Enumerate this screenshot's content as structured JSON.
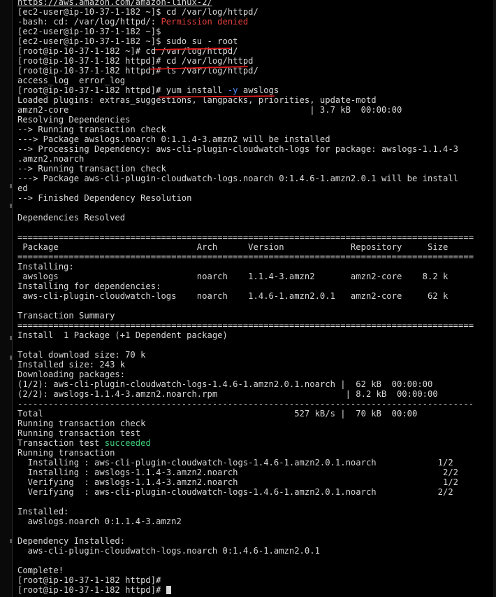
{
  "terminal": {
    "lines": [
      {
        "segments": [
          {
            "text": "https://aws.amazon.com/amazon-linux-2/",
            "kind": "link"
          }
        ]
      },
      {
        "segments": [
          {
            "text": "[ec2-user@ip-10-37-1-182 ~]$ cd /var/log/httpd/"
          }
        ]
      },
      {
        "segments": [
          {
            "text": "-bash: cd: /var/log/httpd/: "
          },
          {
            "text": "Permission denied",
            "kind": "err"
          }
        ]
      },
      {
        "segments": [
          {
            "text": "[ec2-user@ip-10-37-1-182 ~]$"
          }
        ]
      },
      {
        "segments": [
          {
            "text": "[ec2-user@ip-10-37-1-182 ~]$ sudo su - root"
          }
        ]
      },
      {
        "segments": [
          {
            "text": "[root@ip-10-37-1-182 ~]# cd /var/log/httpd/"
          }
        ]
      },
      {
        "segments": [
          {
            "text": "[root@ip-10-37-1-182 httpd]# cd /var/log/httpd"
          }
        ]
      },
      {
        "segments": [
          {
            "text": "[root@ip-10-37-1-182 httpd]# ls /var/log/httpd/"
          }
        ]
      },
      {
        "segments": [
          {
            "text": "access_log  error_log"
          }
        ]
      },
      {
        "segments": [
          {
            "text": "[root@ip-10-37-1-182 httpd]# yum install "
          },
          {
            "text": "-y",
            "kind": "opt"
          },
          {
            "text": " awslogs"
          }
        ]
      },
      {
        "segments": [
          {
            "text": "Loaded plugins: extras_suggestions, langpacks, priorities, update-motd"
          }
        ]
      },
      {
        "segments": [
          {
            "text": "amzn2-core                                               | 3.7 kB  00:00:00"
          }
        ]
      },
      {
        "segments": [
          {
            "text": "Resolving Dependencies"
          }
        ]
      },
      {
        "segments": [
          {
            "text": "--> Running transaction check"
          }
        ]
      },
      {
        "segments": [
          {
            "text": "---> Package awslogs.noarch 0:1.1.4-3.amzn2 will be installed"
          }
        ]
      },
      {
        "segments": [
          {
            "text": "--> Processing Dependency: aws-cli-plugin-cloudwatch-logs for package: awslogs-1.1.4-3"
          }
        ]
      },
      {
        "segments": [
          {
            "text": ".amzn2.noarch"
          }
        ]
      },
      {
        "segments": [
          {
            "text": "--> Running transaction check"
          }
        ]
      },
      {
        "segments": [
          {
            "text": "---> Package aws-cli-plugin-cloudwatch-logs.noarch 0:1.4.6-1.amzn2.0.1 will be install"
          }
        ]
      },
      {
        "segments": [
          {
            "text": "ed"
          }
        ]
      },
      {
        "segments": [
          {
            "text": "--> Finished Dependency Resolution"
          }
        ]
      },
      {
        "segments": [
          {
            "text": ""
          }
        ]
      },
      {
        "segments": [
          {
            "text": "Dependencies Resolved"
          }
        ]
      },
      {
        "segments": [
          {
            "text": ""
          }
        ]
      },
      {
        "segments": [
          {
            "text": "========================================================================================="
          }
        ]
      },
      {
        "segments": [
          {
            "text": " Package                           Arch      Version             Repository     Size"
          }
        ]
      },
      {
        "segments": [
          {
            "text": "========================================================================================="
          }
        ]
      },
      {
        "segments": [
          {
            "text": "Installing:"
          }
        ]
      },
      {
        "segments": [
          {
            "text": " awslogs                           noarch    1.1.4-3.amzn2       amzn2-core    8.2 k"
          }
        ]
      },
      {
        "segments": [
          {
            "text": "Installing for dependencies:"
          }
        ]
      },
      {
        "segments": [
          {
            "text": " aws-cli-plugin-cloudwatch-logs    noarch    1.4.6-1.amzn2.0.1   amzn2-core     62 k"
          }
        ]
      },
      {
        "segments": [
          {
            "text": ""
          }
        ]
      },
      {
        "segments": [
          {
            "text": "Transaction Summary"
          }
        ]
      },
      {
        "segments": [
          {
            "text": "========================================================================================="
          }
        ]
      },
      {
        "segments": [
          {
            "text": "Install  1 Package (+1 Dependent package)"
          }
        ]
      },
      {
        "segments": [
          {
            "text": ""
          }
        ]
      },
      {
        "segments": [
          {
            "text": "Total download size: 70 k"
          }
        ]
      },
      {
        "segments": [
          {
            "text": "Installed size: 243 k"
          }
        ]
      },
      {
        "segments": [
          {
            "text": "Downloading packages:"
          }
        ]
      },
      {
        "segments": [
          {
            "text": "(1/2): aws-cli-plugin-cloudwatch-logs-1.4.6-1.amzn2.0.1.noarch |  62 kB  00:00:00"
          }
        ]
      },
      {
        "segments": [
          {
            "text": "(2/2): awslogs-1.1.4-3.amzn2.noarch.rpm                         | 8.2 kB  00:00:00"
          }
        ]
      },
      {
        "segments": [
          {
            "text": "-----------------------------------------------------------------------------------------"
          }
        ]
      },
      {
        "segments": [
          {
            "text": "Total                                                 527 kB/s |  70 kB  00:00"
          }
        ]
      },
      {
        "segments": [
          {
            "text": "Running transaction check"
          }
        ]
      },
      {
        "segments": [
          {
            "text": "Running transaction test"
          }
        ]
      },
      {
        "segments": [
          {
            "text": "Transaction test "
          },
          {
            "text": "succeeded",
            "kind": "ok"
          }
        ]
      },
      {
        "segments": [
          {
            "text": "Running transaction"
          }
        ]
      },
      {
        "segments": [
          {
            "text": "  Installing : aws-cli-plugin-cloudwatch-logs-1.4.6-1.amzn2.0.1.noarch            1/2"
          }
        ]
      },
      {
        "segments": [
          {
            "text": "  Installing : awslogs-1.1.4-3.amzn2.noarch                                        2/2"
          }
        ]
      },
      {
        "segments": [
          {
            "text": "  Verifying  : awslogs-1.1.4-3.amzn2.noarch                                        1/2"
          }
        ]
      },
      {
        "segments": [
          {
            "text": "  Verifying  : aws-cli-plugin-cloudwatch-logs-1.4.6-1.amzn2.0.1.noarch            2/2"
          }
        ]
      },
      {
        "segments": [
          {
            "text": ""
          }
        ]
      },
      {
        "segments": [
          {
            "text": "Installed:"
          }
        ]
      },
      {
        "segments": [
          {
            "text": "  awslogs.noarch 0:1.1.4-3.amzn2"
          }
        ]
      },
      {
        "segments": [
          {
            "text": ""
          }
        ]
      },
      {
        "segments": [
          {
            "text": "Dependency Installed:"
          }
        ]
      },
      {
        "segments": [
          {
            "text": "  aws-cli-plugin-cloudwatch-logs.noarch 0:1.4.6-1.amzn2.0.1"
          }
        ]
      },
      {
        "segments": [
          {
            "text": ""
          }
        ]
      },
      {
        "segments": [
          {
            "text": "Complete!"
          }
        ]
      },
      {
        "segments": [
          {
            "text": "[root@ip-10-37-1-182 httpd]#"
          }
        ]
      },
      {
        "segments": [
          {
            "text": "[root@ip-10-37-1-182 httpd]# "
          }
        ],
        "cursor": true
      }
    ]
  },
  "colors": {
    "background": "#000000",
    "text": "#d8d8d8",
    "error": "#e0403a",
    "success": "#3fd27a",
    "option": "#5a8cff",
    "annotation": "#e21b1b"
  }
}
